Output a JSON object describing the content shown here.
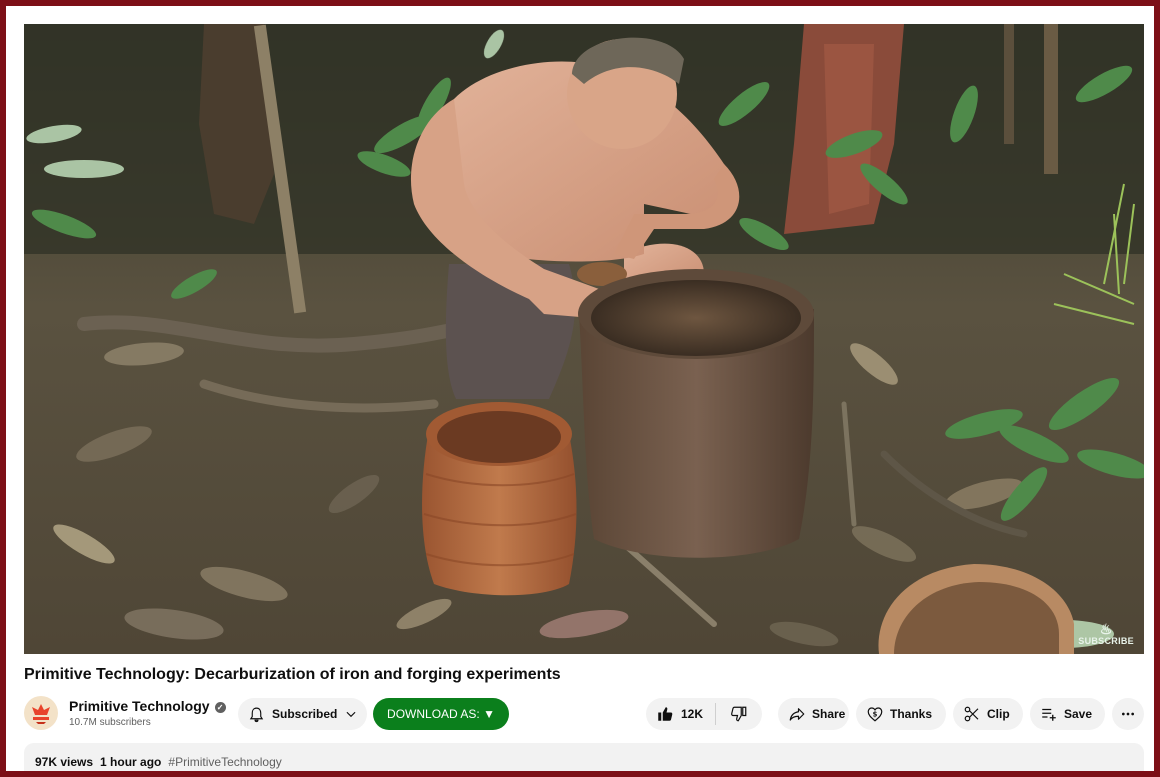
{
  "video": {
    "title": "Primitive Technology: Decarburization of iron and forging experiments",
    "watermark": "SUBSCRIBE"
  },
  "channel": {
    "name": "Primitive Technology",
    "subscribers": "10.7M subscribers",
    "verified": true,
    "avatar_color": "#e8432b"
  },
  "actions": {
    "subscribed_label": "Subscribed",
    "download_label": "DOWNLOAD AS: ▼",
    "like_count": "12K",
    "share_label": "Share",
    "thanks_label": "Thanks",
    "clip_label": "Clip",
    "save_label": "Save"
  },
  "description": {
    "views": "97K views",
    "time": "1 hour ago",
    "hashtag": "#PrimitiveTechnology"
  },
  "colors": {
    "frame_border": "#7d0f17",
    "download_bg": "#0b7f1c",
    "pill_bg": "#f2f2f2"
  },
  "icons": [
    "bell-icon",
    "chevron-down-icon",
    "thumbs-up-icon",
    "thumbs-down-icon",
    "share-icon",
    "thanks-icon",
    "scissors-icon",
    "playlist-add-icon",
    "more-icon",
    "verified-icon"
  ]
}
